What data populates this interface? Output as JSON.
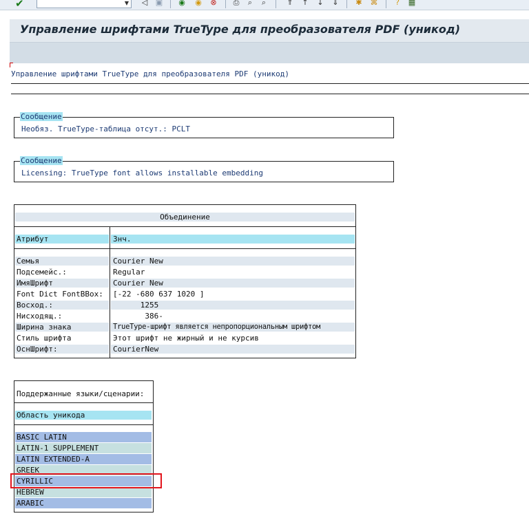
{
  "toolbar": {
    "command_field": "",
    "icons": [
      "enter-icon",
      "back-icon",
      "save-icon",
      "exit-icon",
      "cancel-icon",
      "print-icon",
      "find-icon",
      "find-next-icon",
      "first-page-icon",
      "prev-page-icon",
      "next-page-icon",
      "last-page-icon",
      "new-session-icon",
      "shortcut-icon",
      "help-icon",
      "layout-icon"
    ]
  },
  "title": "Управление шрифтами TrueType для преобразователя PDF (уникод)",
  "report": {
    "heading": "Управление шрифтами TrueType для преобразователя PDF (уникод)",
    "messages": [
      {
        "legend": "Сообщение",
        "text": "Необяз. TrueType-таблица отсут.: PCLT"
      },
      {
        "legend": "Сообщение",
        "text": "Licensing: TrueType font allows installable embedding"
      }
    ],
    "union_table": {
      "title": "Объединение",
      "col_attr": "Атрибут",
      "col_value": "Знч.",
      "rows": [
        {
          "attr": "Семья",
          "value": "Courier New"
        },
        {
          "attr": "Подсемейс.:",
          "value": "Regular"
        },
        {
          "attr": "ИмяШрифт",
          "value": "Courier New"
        },
        {
          "attr": "Font Dict FontBBox:",
          "value": "[-22 -680 637 1020 ]"
        },
        {
          "attr": "Восход.:",
          "value": "      1255"
        },
        {
          "attr": "Нисходящ.:",
          "value": "       386-"
        },
        {
          "attr": "Ширина знака",
          "value": "TrueType-шрифт является непропорциональным шрифтом"
        },
        {
          "attr": "Стиль шрифта",
          "value": "Этот шрифт не жирный и не курсив"
        },
        {
          "attr": "ОснШрифт:",
          "value": "CourierNew"
        }
      ]
    },
    "languages_table": {
      "title": "Поддержанные языки/сценарии:",
      "header": "Область уникода",
      "rows": [
        "BASIC LATIN",
        "LATIN-1 SUPPLEMENT",
        "LATIN EXTENDED-A",
        "GREEK",
        "CYRILLIC",
        "HEBREW",
        "ARABIC"
      ]
    }
  },
  "colors": {
    "header_cyan": "#a6e4f2",
    "row_blue": "#a3bce5",
    "row_teal": "#c6e0e0",
    "highlight_red": "#e2141c",
    "text_blue": "#1c3a73"
  }
}
